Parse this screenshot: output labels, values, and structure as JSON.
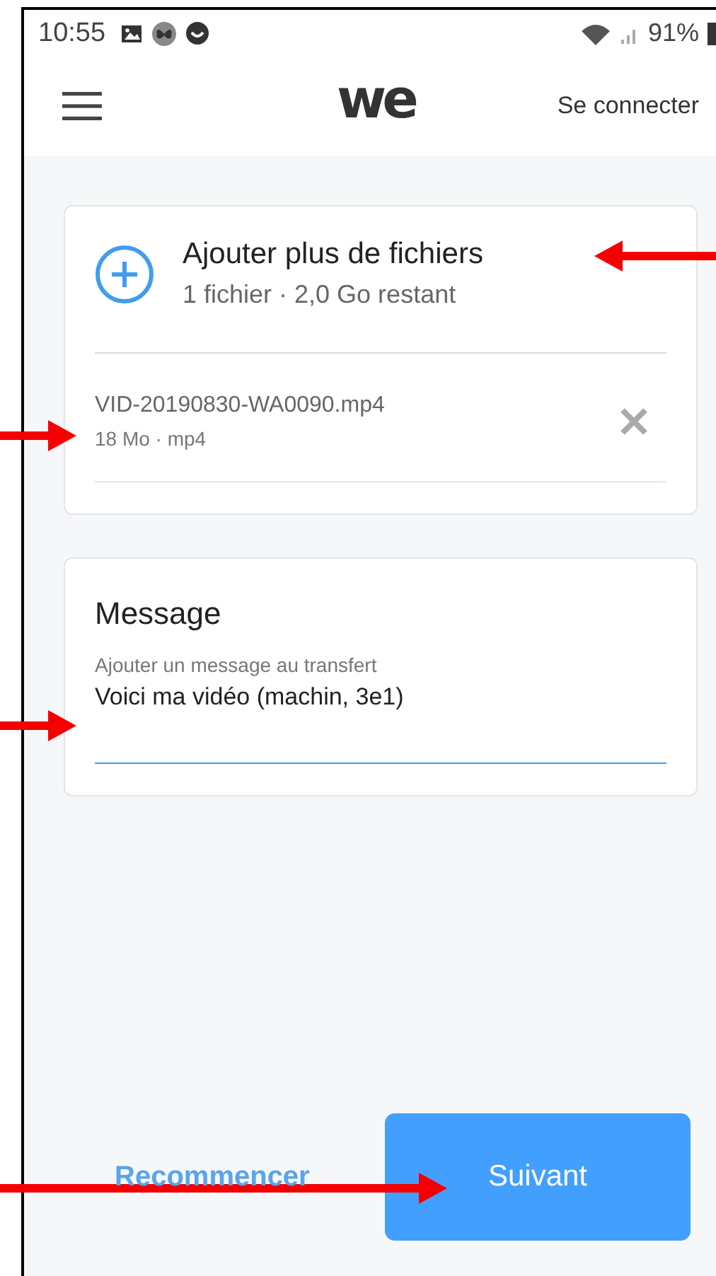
{
  "status_bar": {
    "time": "10:55",
    "notification_icons": [
      {
        "kind": "image"
      },
      {
        "kind": "butterfly"
      },
      {
        "kind": "smiley"
      }
    ],
    "battery": "91%"
  },
  "header": {
    "logo": "we",
    "login_link": "Se connecter"
  },
  "files_card": {
    "title": "Ajouter plus de fichiers",
    "subtitle": "1 fichier · 2,0 Go restant",
    "files": [
      {
        "name": "VID-20190830-WA0090.mp4",
        "meta": "18 Mo · mp4"
      }
    ]
  },
  "message_card": {
    "title": "Message",
    "label": "Ajouter un message au transfert",
    "value": "Voici ma vidéo (machin, 3e1)"
  },
  "actions": {
    "secondary": "Recommencer",
    "primary": "Suivant"
  },
  "annotation_arrows": [
    {
      "kind": "leftward"
    },
    {
      "kind": "rightward"
    },
    {
      "kind": "rightward"
    },
    {
      "kind": "rightward"
    }
  ]
}
